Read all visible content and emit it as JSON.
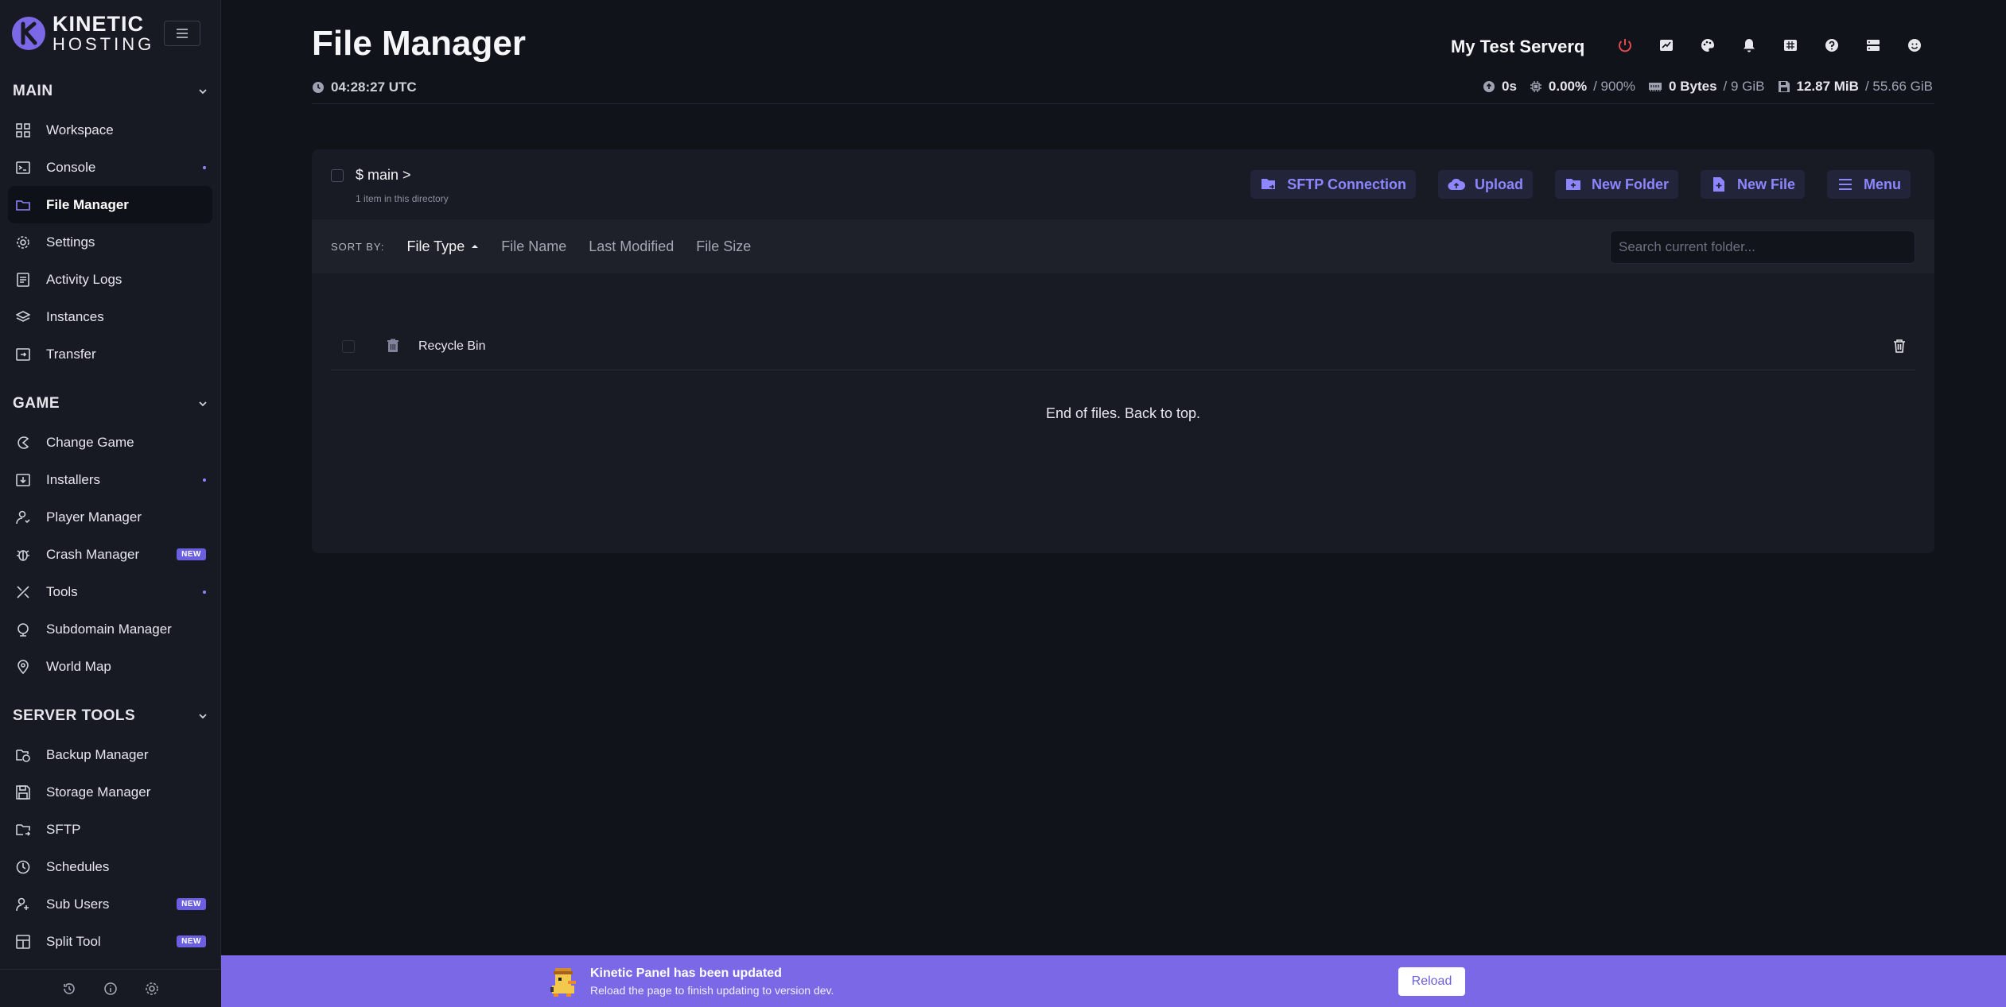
{
  "brand": {
    "line1": "KINETIC",
    "line2": "HOSTING"
  },
  "sections": {
    "main": {
      "title": "MAIN",
      "items": [
        {
          "label": "Workspace",
          "icon": "grid-icon"
        },
        {
          "label": "Console",
          "icon": "terminal-icon"
        },
        {
          "label": "File Manager",
          "icon": "folder-icon"
        },
        {
          "label": "Settings",
          "icon": "gear-icon"
        },
        {
          "label": "Activity Logs",
          "icon": "log-icon"
        },
        {
          "label": "Instances",
          "icon": "layers-icon"
        },
        {
          "label": "Transfer",
          "icon": "transfer-icon"
        }
      ]
    },
    "game": {
      "title": "GAME",
      "items": [
        {
          "label": "Change Game"
        },
        {
          "label": "Installers"
        },
        {
          "label": "Player Manager"
        },
        {
          "label": "Crash Manager",
          "badge": "NEW"
        },
        {
          "label": "Tools"
        },
        {
          "label": "Subdomain Manager"
        },
        {
          "label": "World Map"
        }
      ]
    },
    "server_tools": {
      "title": "SERVER TOOLS",
      "items": [
        {
          "label": "Backup Manager"
        },
        {
          "label": "Storage Manager"
        },
        {
          "label": "SFTP"
        },
        {
          "label": "Schedules"
        },
        {
          "label": "Sub Users",
          "badge": "NEW"
        },
        {
          "label": "Split Tool",
          "badge": "NEW"
        }
      ]
    }
  },
  "header": {
    "title": "File Manager",
    "time": "04:28:27 UTC",
    "server_name": "My Test Serverq",
    "stats": {
      "uptime": "0s",
      "cpu": "0.00%",
      "cpu_limit": "/ 900%",
      "memory": "0 Bytes",
      "memory_limit": "/ 9 GiB",
      "disk": "12.87 MiB",
      "disk_limit": "/ 55.66 GiB"
    }
  },
  "files": {
    "path": "$ main >",
    "count_text": "1 item in this directory",
    "actions": {
      "sftp": "SFTP Connection",
      "upload": "Upload",
      "new_folder": "New Folder",
      "new_file": "New File",
      "menu": "Menu"
    },
    "sort": {
      "label": "SORT BY:",
      "options": [
        "File Type",
        "File Name",
        "Last Modified",
        "File Size"
      ]
    },
    "search_placeholder": "Search current folder...",
    "rows": [
      {
        "name": "Recycle Bin"
      }
    ],
    "end_message": "End of files. Back to top."
  },
  "banner": {
    "title": "Kinetic Panel has been updated",
    "subtitle": "Reload the page to finish updating to version dev.",
    "reload": "Reload"
  },
  "colors": {
    "accent": "#7b68e6",
    "power": "#e5484d",
    "background": "#11131b"
  }
}
